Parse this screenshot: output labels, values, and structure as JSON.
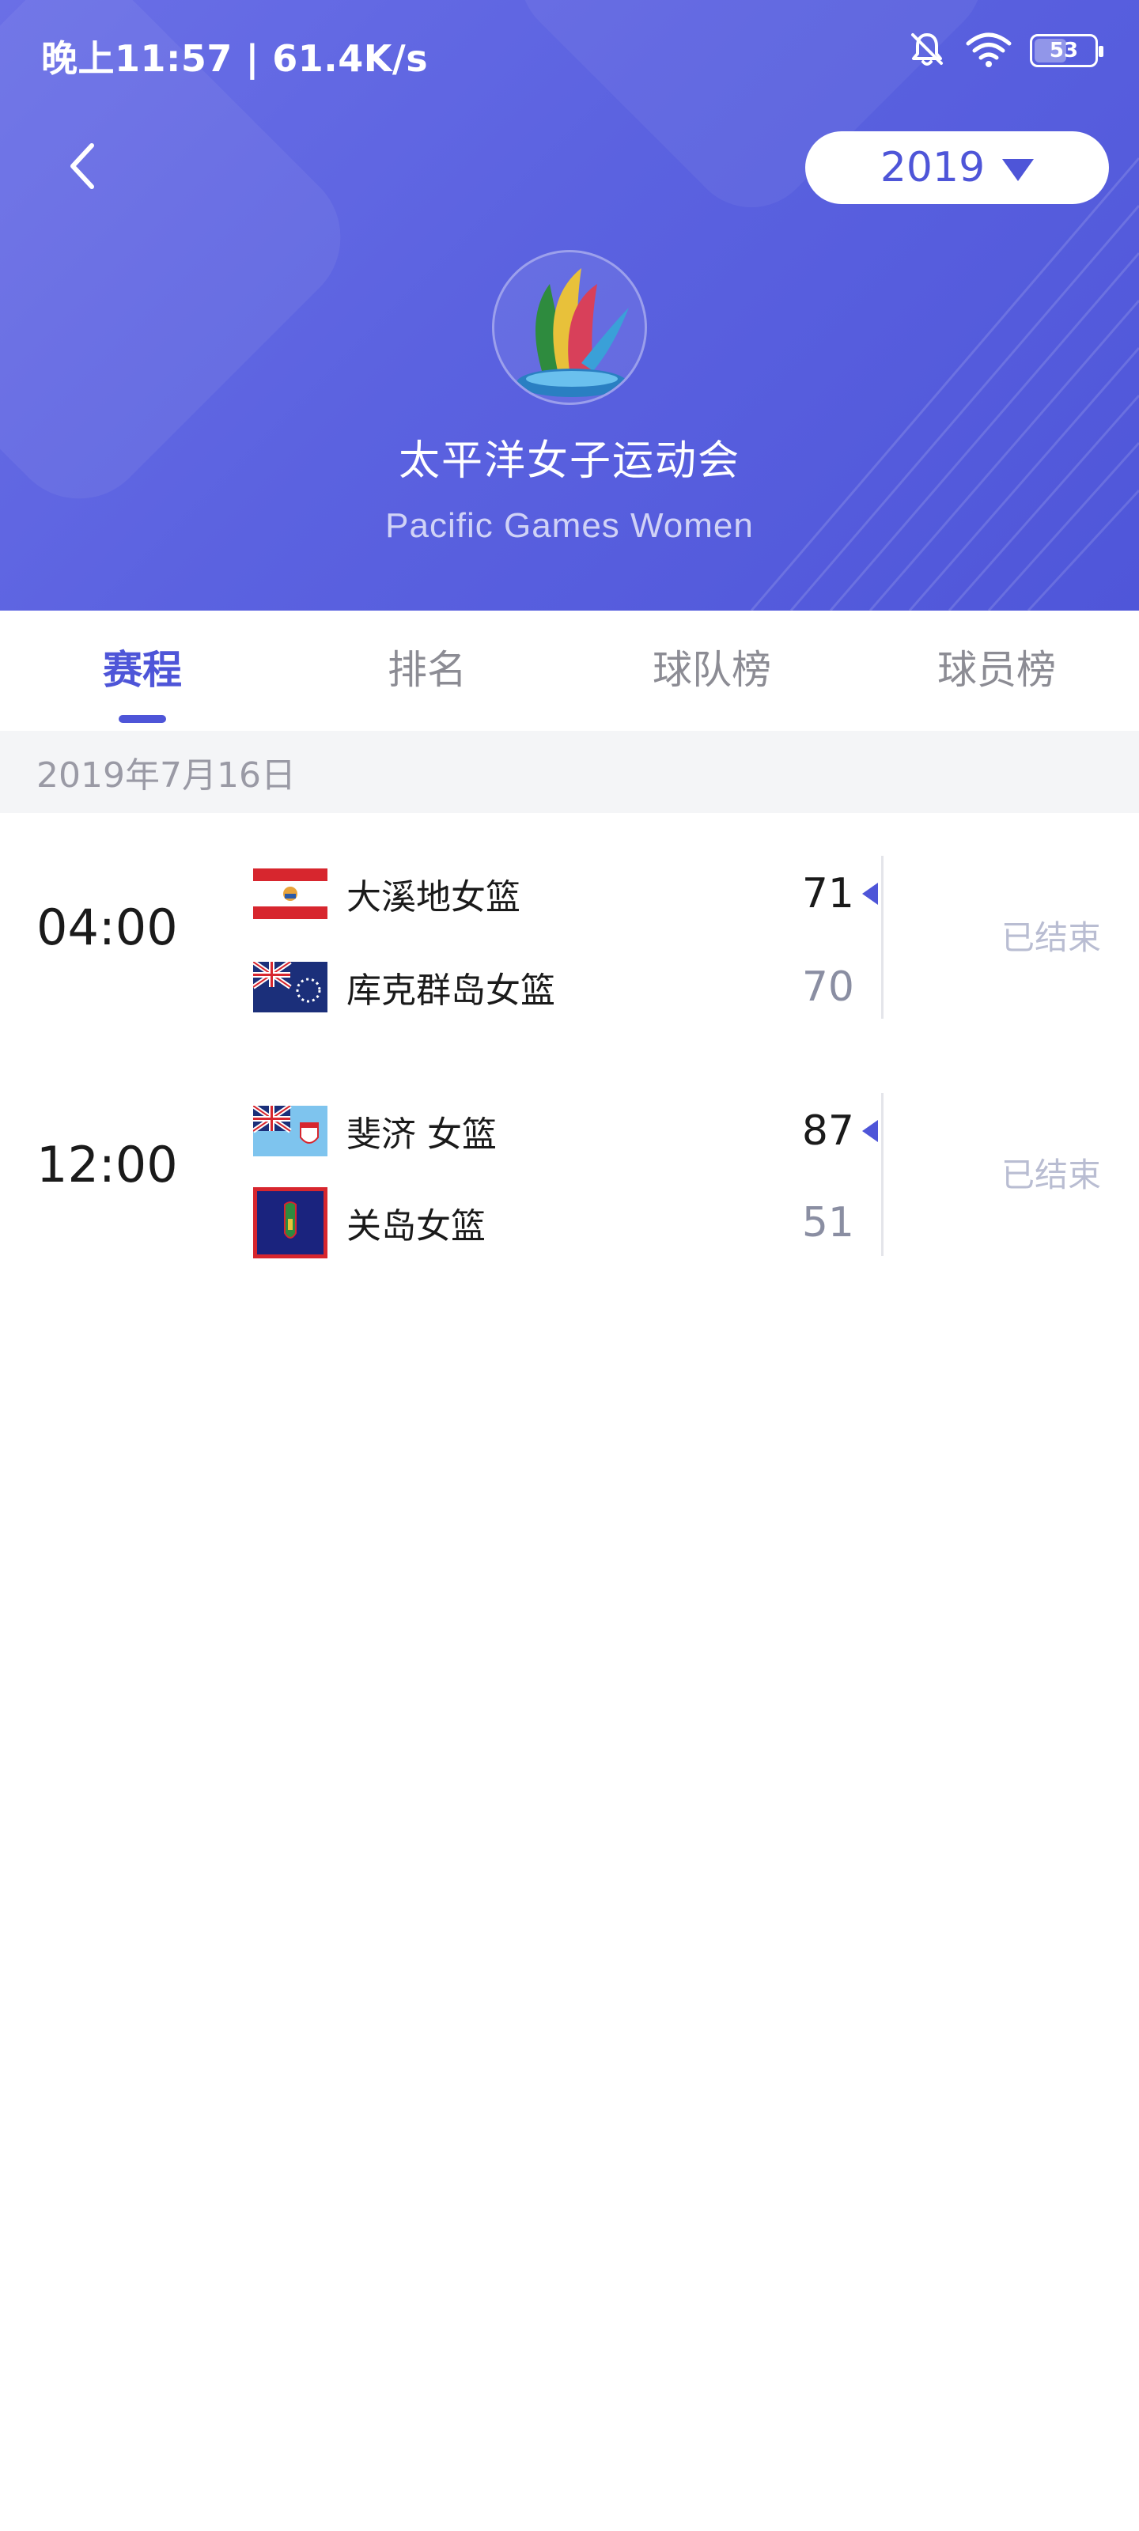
{
  "status_bar": {
    "text": "晚上11:57 | 61.4K/s",
    "battery": "53",
    "icons": [
      "mute-bell-icon",
      "wifi-icon",
      "battery-icon"
    ]
  },
  "header": {
    "year": "2019",
    "title": "太平洋女子运动会",
    "subtitle": "Pacific Games Women",
    "colors": {
      "primary": "#4e55d8",
      "header_gradient_start": "#6a6fe6",
      "header_gradient_end": "#4f56d9"
    }
  },
  "tabs": [
    {
      "label": "赛程",
      "active": true
    },
    {
      "label": "排名",
      "active": false
    },
    {
      "label": "球队榜",
      "active": false
    },
    {
      "label": "球员榜",
      "active": false
    }
  ],
  "date_label": "2019年7月16日",
  "matches": [
    {
      "time": "04:00",
      "home": {
        "name": "大溪地女篮",
        "score": "71",
        "flag": "french-polynesia-flag-icon"
      },
      "away": {
        "name": "库克群岛女篮",
        "score": "70",
        "flag": "cook-islands-flag-icon"
      },
      "status": "已结束"
    },
    {
      "time": "12:00",
      "home": {
        "name": "斐济 女篮",
        "score": "87",
        "flag": "fiji-flag-icon"
      },
      "away": {
        "name": "关岛女篮",
        "score": "51",
        "flag": "guam-flag-icon"
      },
      "status": "已结束"
    }
  ]
}
